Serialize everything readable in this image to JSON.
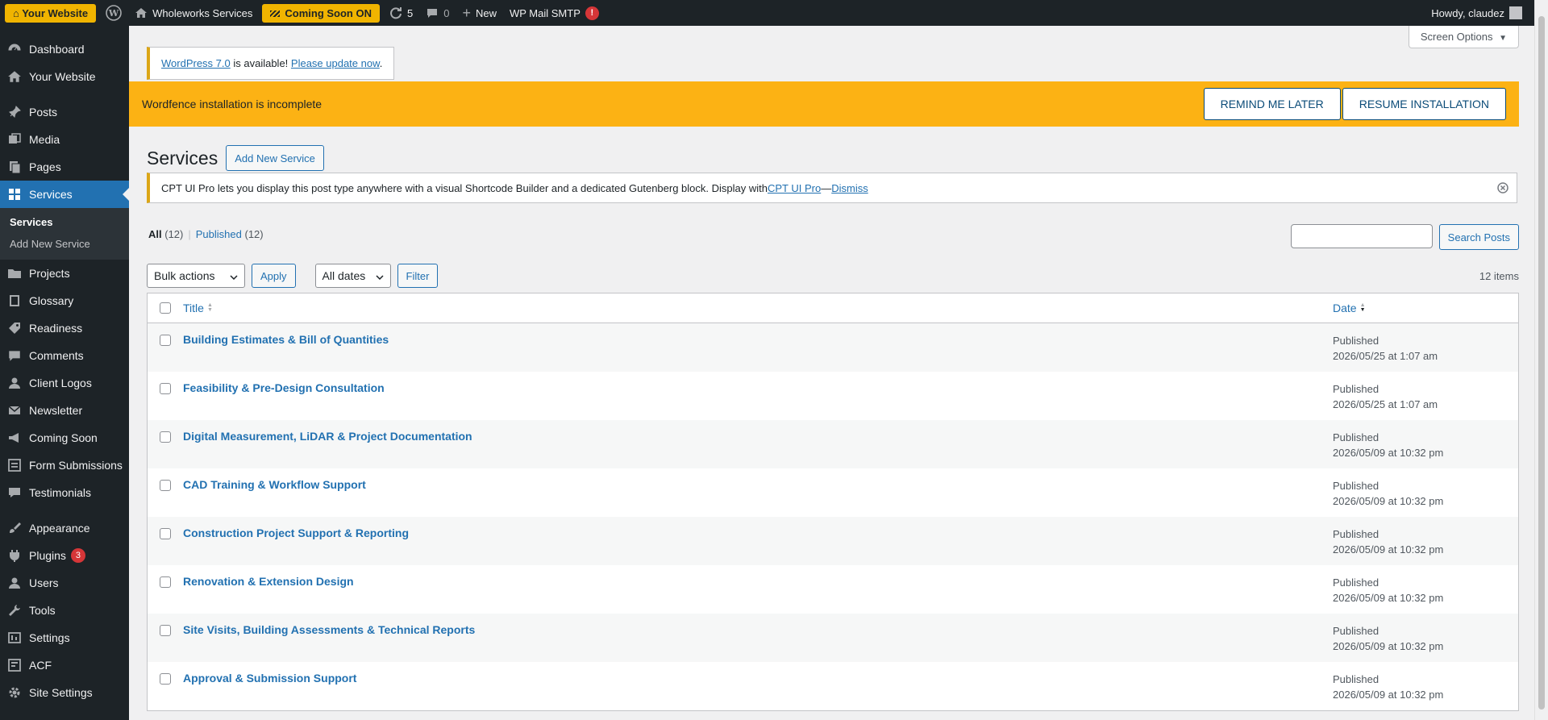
{
  "admin_bar": {
    "site_badge": "⌂ Your Website",
    "site_name": "Wholeworks Services",
    "coming_soon": "Coming Soon ON",
    "updates_count": "5",
    "comments_count": "0",
    "new_label": "New",
    "smtp_label": "WP Mail SMTP",
    "smtp_alert": "!",
    "howdy": "Howdy, claudez"
  },
  "sidebar": {
    "items": [
      {
        "label": "Dashboard",
        "icon": "dashboard-icon"
      },
      {
        "label": "Your Website",
        "icon": "home-icon"
      },
      {
        "label": "Posts",
        "icon": "pin-icon"
      },
      {
        "label": "Media",
        "icon": "media-icon"
      },
      {
        "label": "Pages",
        "icon": "pages-icon"
      },
      {
        "label": "Services",
        "icon": "grid-icon"
      },
      {
        "label": "Projects",
        "icon": "folder-icon"
      },
      {
        "label": "Glossary",
        "icon": "book-icon"
      },
      {
        "label": "Readiness",
        "icon": "tag-icon"
      },
      {
        "label": "Comments",
        "icon": "comment-icon"
      },
      {
        "label": "Client Logos",
        "icon": "user-icon"
      },
      {
        "label": "Newsletter",
        "icon": "mail-icon"
      },
      {
        "label": "Coming Soon",
        "icon": "megaphone-icon"
      },
      {
        "label": "Form Submissions",
        "icon": "form-icon"
      },
      {
        "label": "Testimonials",
        "icon": "quote-icon"
      },
      {
        "label": "Appearance",
        "icon": "brush-icon"
      },
      {
        "label": "Plugins",
        "icon": "plug-icon",
        "badge": "3"
      },
      {
        "label": "Users",
        "icon": "users-icon"
      },
      {
        "label": "Tools",
        "icon": "wrench-icon"
      },
      {
        "label": "Settings",
        "icon": "settings-icon"
      },
      {
        "label": "ACF",
        "icon": "acf-icon"
      },
      {
        "label": "Site Settings",
        "icon": "gear-icon"
      }
    ],
    "submenu": [
      "Services",
      "Add New Service"
    ]
  },
  "screen_options": "Screen Options",
  "update_nag": {
    "link1": "WordPress 7.0",
    "text": " is available! ",
    "link2": "Please update now",
    "end": "."
  },
  "wordfence": {
    "text": "Wordfence installation is incomplete",
    "remind": "REMIND ME LATER",
    "resume": "RESUME INSTALLATION"
  },
  "page": {
    "title": "Services",
    "add_new": "Add New Service"
  },
  "cpt_notice": {
    "text": "CPT UI Pro lets you display this post type anywhere with a visual Shortcode Builder and a dedicated Gutenberg block. Display with ",
    "link": "CPT UI Pro",
    "dash": " — ",
    "dismiss": "Dismiss"
  },
  "filters": {
    "all_label": "All",
    "all_count": "(12)",
    "published_label": "Published",
    "published_count": "(12)",
    "search_button": "Search Posts",
    "bulk_actions": "Bulk actions",
    "apply": "Apply",
    "all_dates": "All dates",
    "filter": "Filter",
    "items_count": "12 items"
  },
  "table": {
    "col_title": "Title",
    "col_date": "Date",
    "rows": [
      {
        "title": "Building Estimates & Bill of Quantities",
        "status": "Published",
        "date": "2026/05/25 at 1:07 am"
      },
      {
        "title": "Feasibility & Pre-Design Consultation",
        "status": "Published",
        "date": "2026/05/25 at 1:07 am"
      },
      {
        "title": "Digital Measurement, LiDAR & Project Documentation",
        "status": "Published",
        "date": "2026/05/09 at 10:32 pm"
      },
      {
        "title": "CAD Training & Workflow Support",
        "status": "Published",
        "date": "2026/05/09 at 10:32 pm"
      },
      {
        "title": "Construction Project Support & Reporting",
        "status": "Published",
        "date": "2026/05/09 at 10:32 pm"
      },
      {
        "title": "Renovation & Extension Design",
        "status": "Published",
        "date": "2026/05/09 at 10:32 pm"
      },
      {
        "title": "Site Visits, Building Assessments & Technical Reports",
        "status": "Published",
        "date": "2026/05/09 at 10:32 pm"
      },
      {
        "title": "Approval & Submission Support",
        "status": "Published",
        "date": "2026/05/09 at 10:32 pm"
      }
    ]
  }
}
